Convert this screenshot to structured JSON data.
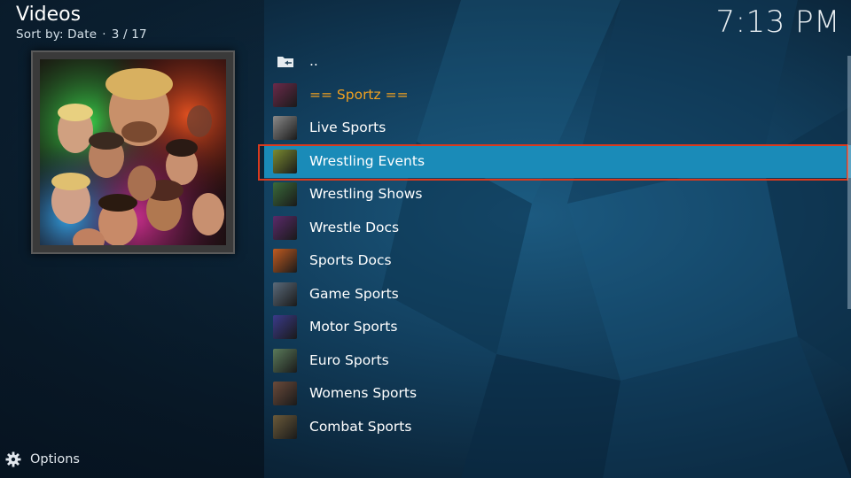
{
  "header": {
    "title": "Videos",
    "sort_label": "Sort by: Date",
    "position": "3 / 17"
  },
  "clock": "7:13 PM",
  "list": {
    "items": [
      {
        "label": "..",
        "kind": "parent-folder",
        "icon": "folder-back-icon"
      },
      {
        "label": "== Sportz ==",
        "kind": "heading",
        "thumb_color": "#6a2a4a"
      },
      {
        "label": "Live Sports",
        "kind": "item",
        "thumb_color": "#8a8a8a"
      },
      {
        "label": "Wrestling Events",
        "kind": "item",
        "selected": true,
        "thumb_color": "#7a8a30"
      },
      {
        "label": "Wrestling Shows",
        "kind": "item",
        "thumb_color": "#3a6a3a"
      },
      {
        "label": "Wrestle Docs",
        "kind": "item",
        "thumb_color": "#5a2a6a"
      },
      {
        "label": "Sports Docs",
        "kind": "item",
        "thumb_color": "#c05a20"
      },
      {
        "label": "Game Sports",
        "kind": "item",
        "thumb_color": "#5a6a7a"
      },
      {
        "label": "Motor Sports",
        "kind": "item",
        "thumb_color": "#3a3a8a"
      },
      {
        "label": "Euro Sports",
        "kind": "item",
        "thumb_color": "#5a7a5a"
      },
      {
        "label": "Womens Sports",
        "kind": "item",
        "thumb_color": "#6a4a3a"
      },
      {
        "label": "Combat Sports",
        "kind": "item",
        "thumb_color": "#6a5a3a"
      }
    ]
  },
  "footer": {
    "options_label": "Options"
  },
  "colors": {
    "heading": "#f0a020",
    "selected_bg": "#1a8bb8",
    "focus_border": "#d93a1e"
  }
}
